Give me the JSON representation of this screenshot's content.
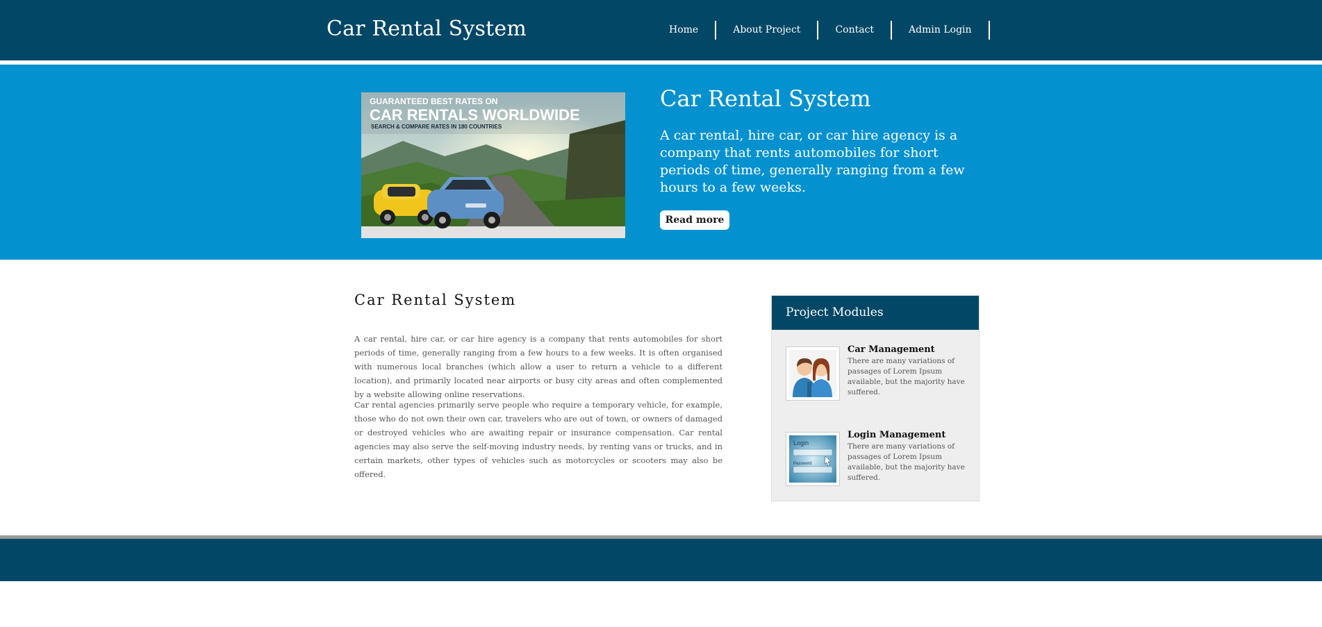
{
  "header": {
    "site_title": "Car Rental System",
    "nav": [
      {
        "label": "Home"
      },
      {
        "label": "About Project"
      },
      {
        "label": "Contact"
      },
      {
        "label": "Admin Login"
      }
    ]
  },
  "hero": {
    "image": {
      "line1": "GUARANTEED BEST RATES ON",
      "line2": "CAR RENTALS WORLDWIDE",
      "line3": "SEARCH & COMPARE RATES IN 180 COUNTRIES"
    },
    "title": "Car Rental System",
    "text": "A car rental, hire car, or car hire agency is a company that rents automobiles for short periods of time, generally ranging from a few hours to a few weeks.",
    "read_more": "Read more"
  },
  "main": {
    "title": "Car Rental System",
    "paragraphs": [
      "A car rental, hire car, or car hire agency is a company that rents automobiles for short periods of time, generally ranging from a few hours to a few weeks. It is often organised with numerous local branches (which allow a user to return a vehicle to a different location), and primarily located near airports or busy city areas and often complemented by a website allowing online reservations.",
      "Car rental agencies primarily serve people who require a temporary vehicle, for example, those who do not own their own car, travelers who are out of town, or owners of damaged or destroyed vehicles who are awaiting repair or insurance compensation. Car rental agencies may also serve the self-moving industry needs, by renting vans or trucks, and in certain markets, other types of vehicles such as motorcycles or scooters may also be offered."
    ]
  },
  "sidebar": {
    "title": "Project Modules",
    "modules": [
      {
        "title": "Car Management",
        "text": "There are many variations of passages of Lorem Ipsum available, but the majority have suffered.",
        "icon": "users-icon"
      },
      {
        "title": "Login Management",
        "text": "There are many variations of passages of Lorem Ipsum available, but the majority have suffered.",
        "icon": "login-form-icon",
        "thumb_label": "Login",
        "thumb_field": "Password"
      }
    ]
  },
  "colors": {
    "header_bg": "#034766",
    "hero_bg": "#0391cf",
    "sidebar_bg": "#eeeeee",
    "footer_bg": "#034766"
  }
}
